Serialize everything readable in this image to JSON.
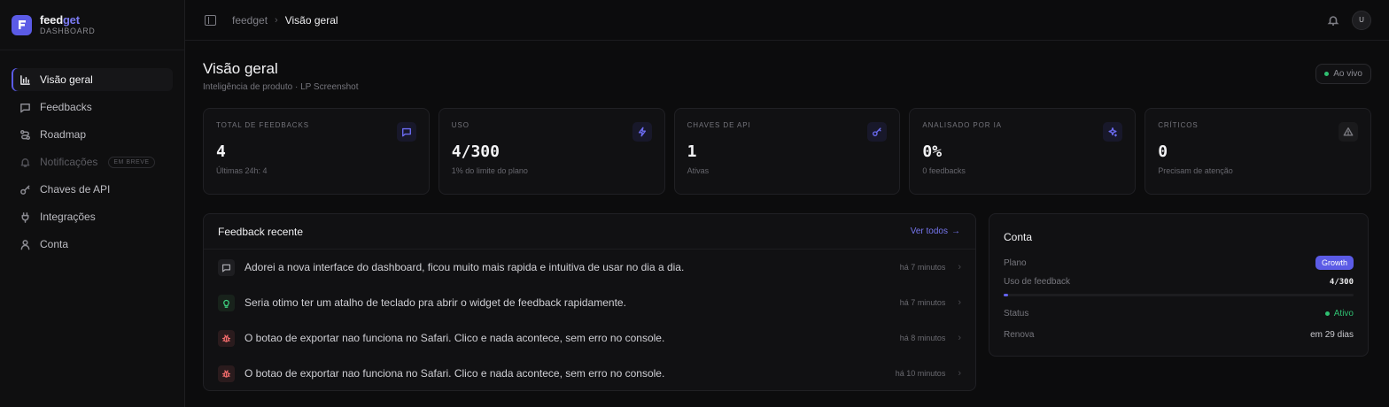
{
  "brand": {
    "name_a": "feed",
    "name_b": "get",
    "sub": "DASHBOARD"
  },
  "nav": {
    "items": [
      {
        "label": "Visão geral",
        "icon": "bar-chart-icon",
        "active": true
      },
      {
        "label": "Feedbacks",
        "icon": "message-square-icon"
      },
      {
        "label": "Roadmap",
        "icon": "roadmap-icon"
      },
      {
        "label": "Notificações",
        "icon": "bell-icon",
        "disabled": true,
        "badge": "EM BREVE"
      },
      {
        "label": "Chaves de API",
        "icon": "key-icon"
      },
      {
        "label": "Integrações",
        "icon": "plug-icon"
      },
      {
        "label": "Conta",
        "icon": "user-icon"
      }
    ]
  },
  "topbar": {
    "crumb_root": "feedget",
    "crumb_sep": "›",
    "crumb_current": "Visão geral",
    "avatar": "U"
  },
  "page": {
    "title": "Visão geral",
    "subtitle": "Inteligência de produto · LP Screenshot",
    "live_label": "Ao vivo"
  },
  "stats": [
    {
      "label": "TOTAL DE FEEDBACKS",
      "value": "4",
      "sub": "Últimas 24h: 4",
      "icon": "message-square-icon"
    },
    {
      "label": "USO",
      "value": "4/300",
      "sub": "1% do limite do plano",
      "icon": "zap-icon"
    },
    {
      "label": "CHAVES DE API",
      "value": "1",
      "sub": "Ativas",
      "icon": "key-icon"
    },
    {
      "label": "ANALISADO POR IA",
      "value": "0%",
      "sub": "0 feedbacks",
      "icon": "sparkles-icon"
    },
    {
      "label": "CRÍTICOS",
      "value": "0",
      "sub": "Precisam de atenção",
      "icon": "alert-triangle-icon"
    }
  ],
  "recent": {
    "title": "Feedback recente",
    "see_all": "Ver todos",
    "items": [
      {
        "text": "Adorei a nova interface do dashboard, ficou muito mais rapida e intuitiva de usar no dia a dia.",
        "time": "há 7 minutos",
        "type": "comment"
      },
      {
        "text": "Seria otimo ter um atalho de teclado pra abrir o widget de feedback rapidamente.",
        "time": "há 7 minutos",
        "type": "idea"
      },
      {
        "text": "O botao de exportar nao funciona no Safari. Clico e nada acontece, sem erro no console.",
        "time": "há 8 minutos",
        "type": "bug"
      },
      {
        "text": "O botao de exportar nao funciona no Safari. Clico e nada acontece, sem erro no console.",
        "time": "há 10 minutos",
        "type": "bug"
      }
    ]
  },
  "account": {
    "title": "Conta",
    "plan_label": "Plano",
    "plan_value": "Growth",
    "usage_label": "Uso de feedback",
    "usage_value": "4/300",
    "usage_fraction": 0.0133,
    "status_label": "Status",
    "status_value": "Ativo",
    "renew_label": "Renova",
    "renew_value": "em 29 dias"
  },
  "colors": {
    "accent": "#5b5be6",
    "success": "#2fbf71",
    "danger": "#f06b6b"
  }
}
